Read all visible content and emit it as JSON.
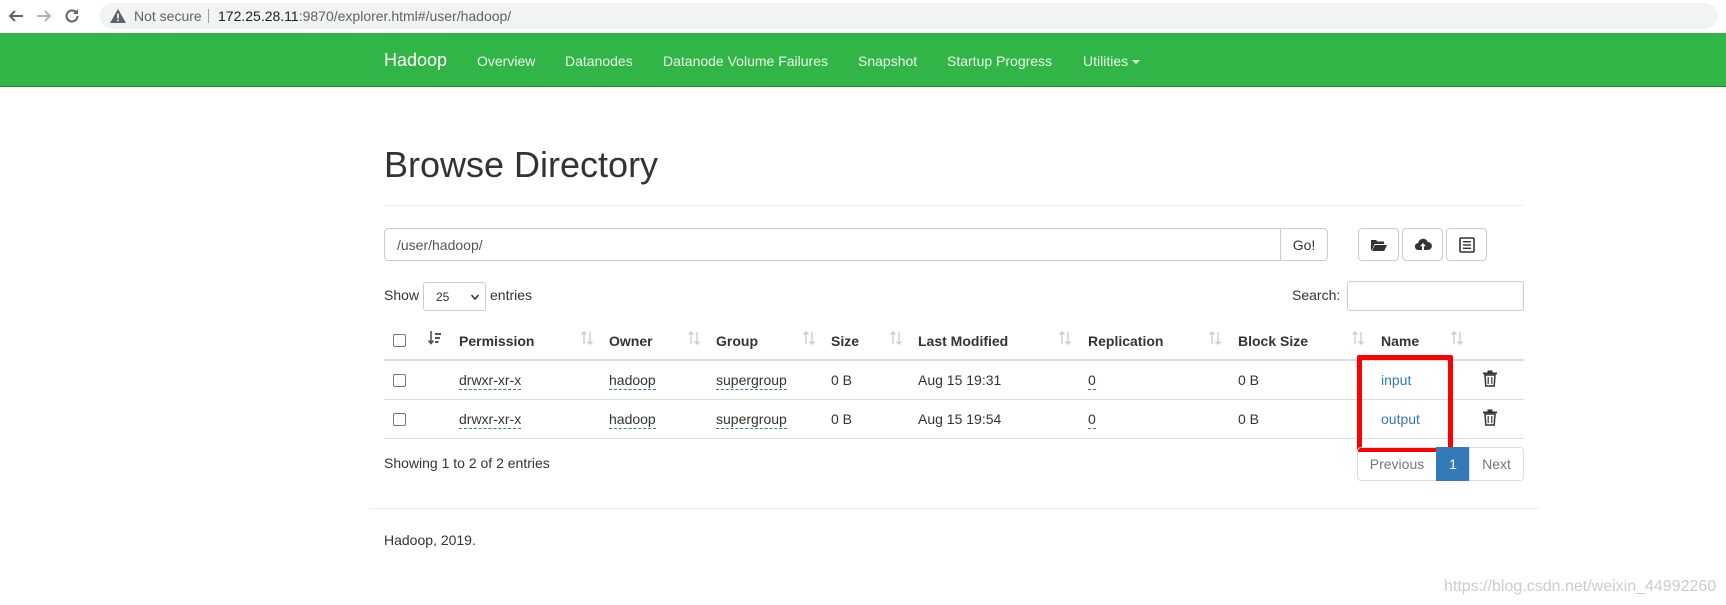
{
  "browser": {
    "security_label": "Not secure",
    "url_host": "172.25.28.11",
    "url_rest": ":9870/explorer.html#/user/hadoop/"
  },
  "navbar": {
    "brand": "Hadoop",
    "links": [
      "Overview",
      "Datanodes",
      "Datanode Volume Failures",
      "Snapshot",
      "Startup Progress",
      "Utilities"
    ]
  },
  "page": {
    "title": "Browse Directory",
    "path_value": "/user/hadoop/",
    "go_label": "Go!"
  },
  "table_controls": {
    "show_label": "Show",
    "page_length": "25",
    "entries_label": "entries",
    "search_label": "Search:",
    "search_value": ""
  },
  "table": {
    "columns": [
      "Permission",
      "Owner",
      "Group",
      "Size",
      "Last Modified",
      "Replication",
      "Block Size",
      "Name"
    ],
    "rows": [
      {
        "permission": "drwxr-xr-x",
        "owner": "hadoop",
        "group": "supergroup",
        "size": "0 B",
        "last_modified": "Aug 15 19:31",
        "replication": "0",
        "block_size": "0 B",
        "name": "input"
      },
      {
        "permission": "drwxr-xr-x",
        "owner": "hadoop",
        "group": "supergroup",
        "size": "0 B",
        "last_modified": "Aug 15 19:54",
        "replication": "0",
        "block_size": "0 B",
        "name": "output"
      }
    ]
  },
  "pagination": {
    "info": "Showing 1 to 2 of 2 entries",
    "previous": "Previous",
    "current": "1",
    "next": "Next"
  },
  "footer": {
    "text": "Hadoop, 2019.",
    "watermark": "https://blog.csdn.net/weixin_44992260"
  },
  "colors": {
    "navbar": "#31b546",
    "link": "#337ab7",
    "highlight_box": "#ff0000"
  },
  "icons": [
    "back-arrow-icon",
    "forward-arrow-icon",
    "reload-icon",
    "warning-icon",
    "folder-open-icon",
    "cloud-upload-icon",
    "list-alt-icon",
    "sort-icon",
    "trash-icon"
  ]
}
